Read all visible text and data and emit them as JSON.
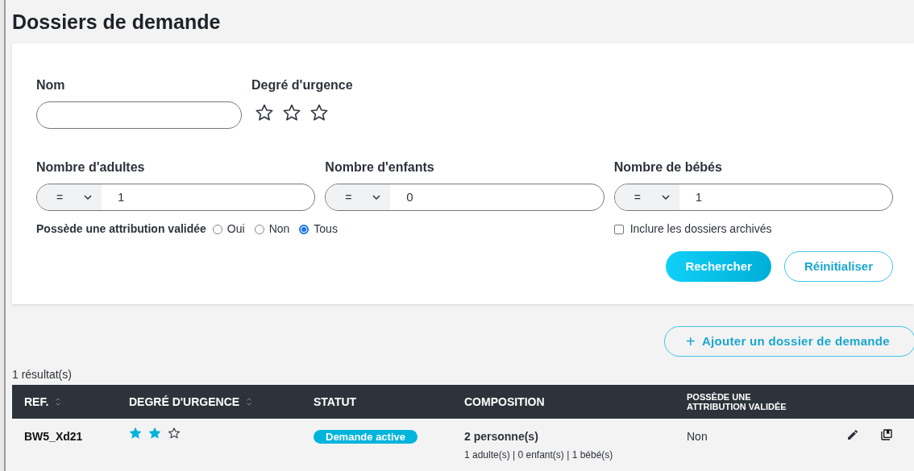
{
  "title": "Dossiers de demande",
  "filters": {
    "name": {
      "label": "Nom"
    },
    "urgency": {
      "label": "Degré d'urgence",
      "stars": 0
    },
    "counts": [
      {
        "label": "Nombre d'adultes",
        "operator": "=",
        "value": "1"
      },
      {
        "label": "Nombre d'enfants",
        "operator": "=",
        "value": "0"
      },
      {
        "label": "Nombre de bébés",
        "operator": "=",
        "value": "1"
      }
    ],
    "attribution": {
      "label": "Possède une attribution validée",
      "options": [
        {
          "label": "Oui",
          "selected": false
        },
        {
          "label": "Non",
          "selected": false
        },
        {
          "label": "Tous",
          "selected": true
        }
      ]
    },
    "archived": {
      "label": "Inclure les dossiers archivés",
      "checked": false
    },
    "buttons": [
      {
        "label": "Rechercher",
        "kind": "primary"
      },
      {
        "label": "Réinitialiser",
        "kind": "outline"
      }
    ]
  },
  "add_button": {
    "icon": "+",
    "label": "Ajouter un dossier de demande"
  },
  "result_count": "1 résultat(s)",
  "table": {
    "columns": [
      {
        "label": "REF.",
        "sortable": true
      },
      {
        "label": "DEGRÉ D'URGENCE",
        "sortable": true
      },
      {
        "label": "STATUT",
        "sortable": false
      },
      {
        "label": "COMPOSITION",
        "sortable": false
      },
      {
        "label": "POSSÈDE UNE ATTRIBUTION VALIDÉE",
        "sortable": false
      }
    ],
    "rows": [
      {
        "ref": "BW5_Xd21",
        "stars": 2,
        "status": "Demande active",
        "composition": "2 personne(s)",
        "composition_detail": "1 adulte(s) | 0 enfant(s) | 1 bébé(s)",
        "attribution": "Non"
      }
    ]
  }
}
